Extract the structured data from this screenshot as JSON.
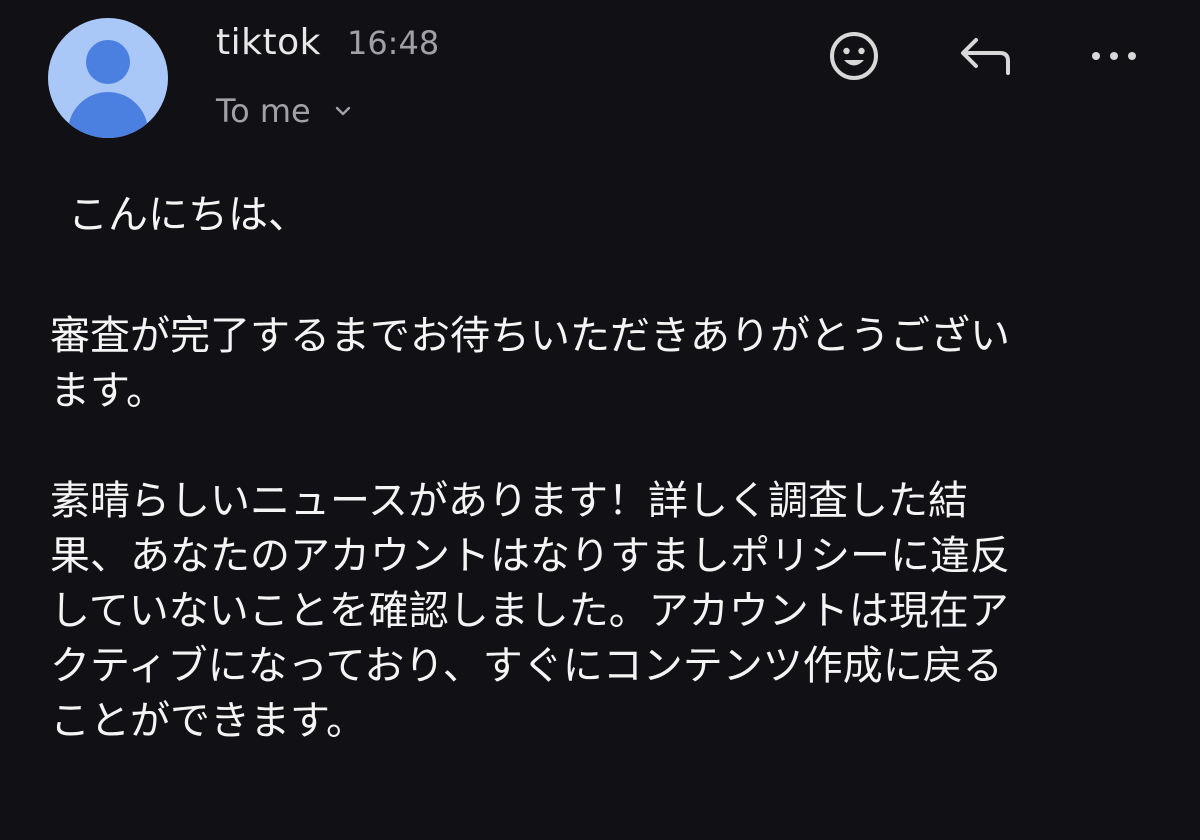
{
  "colors": {
    "background": "#111014",
    "avatar_bg": "#a9c7f7",
    "avatar_fg": "#4b7fe0",
    "primary_text": "#f4f4f4",
    "secondary_text": "#a0a0a6",
    "icon": "#d8d8d8"
  },
  "header": {
    "sender": "tiktok",
    "time": "16:48",
    "recipient": "To me",
    "icons": [
      "avatar",
      "emoji-reaction-icon",
      "reply-icon",
      "more-options-icon",
      "chevron-down-icon"
    ]
  },
  "body": {
    "greeting": "こんにちは、",
    "paragraph1": {
      "line1": "審査が完了するまでお待ちいただきありがとうござい",
      "line2": "ます。"
    },
    "paragraph2": {
      "line1": "素晴らしいニュースがあります！詳しく調査した結",
      "line2": "果、あなたのアカウントはなりすましポリシーに違反",
      "line3": "していないことを確認しました。アカウントは現在ア",
      "line4": "クティブになっており、すぐにコンテンツ作成に戻る",
      "line5": "ことができます。"
    }
  }
}
